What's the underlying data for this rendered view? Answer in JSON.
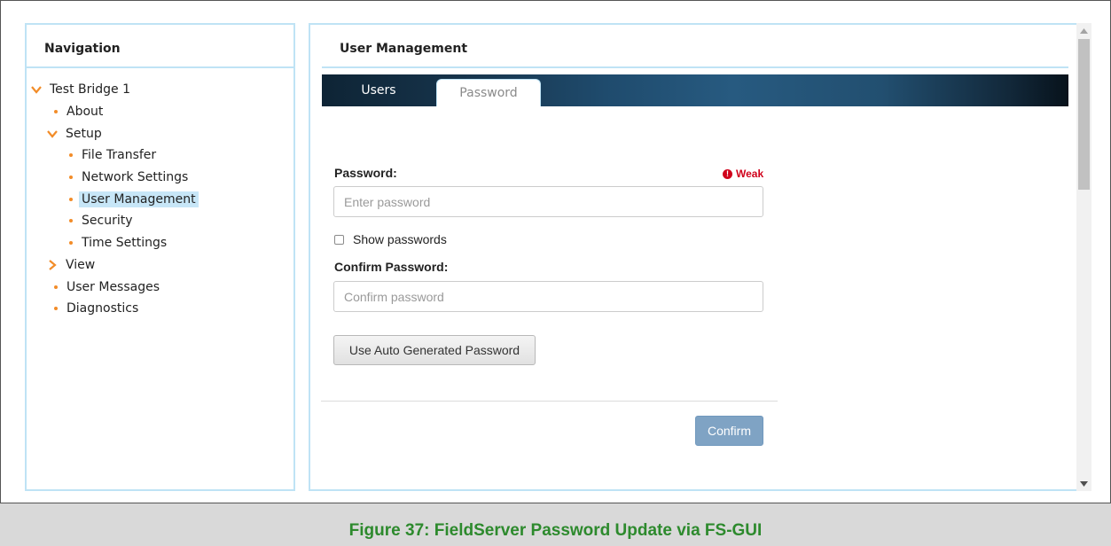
{
  "navigation": {
    "title": "Navigation",
    "items": [
      {
        "label": "Test Bridge 1",
        "marker": "chevron-down-icon",
        "level": 0
      },
      {
        "label": "About",
        "marker": "bullet",
        "level": 1
      },
      {
        "label": "Setup",
        "marker": "chevron-down-icon",
        "level": 1
      },
      {
        "label": "File Transfer",
        "marker": "bullet",
        "level": 2
      },
      {
        "label": "Network Settings",
        "marker": "bullet",
        "level": 2
      },
      {
        "label": "User Management",
        "marker": "bullet",
        "level": 2,
        "selected": true
      },
      {
        "label": "Security",
        "marker": "bullet",
        "level": 2
      },
      {
        "label": "Time Settings",
        "marker": "bullet",
        "level": 2
      },
      {
        "label": "View",
        "marker": "chevron-right-icon",
        "level": 1
      },
      {
        "label": "User Messages",
        "marker": "bullet",
        "level": 1
      },
      {
        "label": "Diagnostics",
        "marker": "bullet",
        "level": 1
      }
    ]
  },
  "main": {
    "title": "User Management",
    "tabs": [
      {
        "label": "Users",
        "active": false
      },
      {
        "label": "Password",
        "active": true
      }
    ],
    "form": {
      "password_label": "Password:",
      "strength_label": "Weak",
      "password_placeholder": "Enter password",
      "password_value": "",
      "show_passwords_label": "Show passwords",
      "show_passwords_checked": false,
      "confirm_label": "Confirm Password:",
      "confirm_placeholder": "Confirm password",
      "confirm_value": "",
      "auto_generate_label": "Use Auto Generated Password",
      "confirm_button_label": "Confirm"
    }
  },
  "caption": "Figure 37: FieldServer Password Update via FS-GUI",
  "colors": {
    "accent_orange": "#f28c28",
    "panel_border": "#bfe3f5",
    "selection_bg": "#c7e6f7",
    "weak_red": "#d0021b",
    "confirm_button": "#7fa3c4",
    "caption_green": "#2d8a2d"
  }
}
